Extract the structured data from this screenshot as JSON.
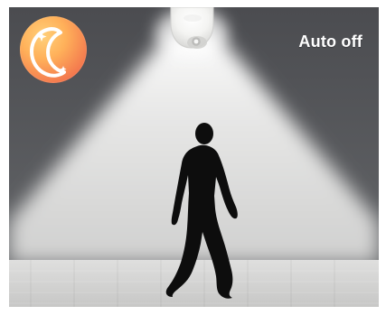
{
  "status": {
    "label": "Auto off"
  },
  "icons": {
    "mode": "moon-icon",
    "sensor": "motion-sensor-bulb-icon",
    "person": "walking-person-icon"
  },
  "colors": {
    "wall": "#5d5e61",
    "light": "#f3f4f2",
    "floor": "#d5d5d4",
    "badge_top": "#ffcf79",
    "badge_bottom": "#ee6548",
    "silhouette": "#0d0d0d",
    "text": "#ffffff"
  }
}
